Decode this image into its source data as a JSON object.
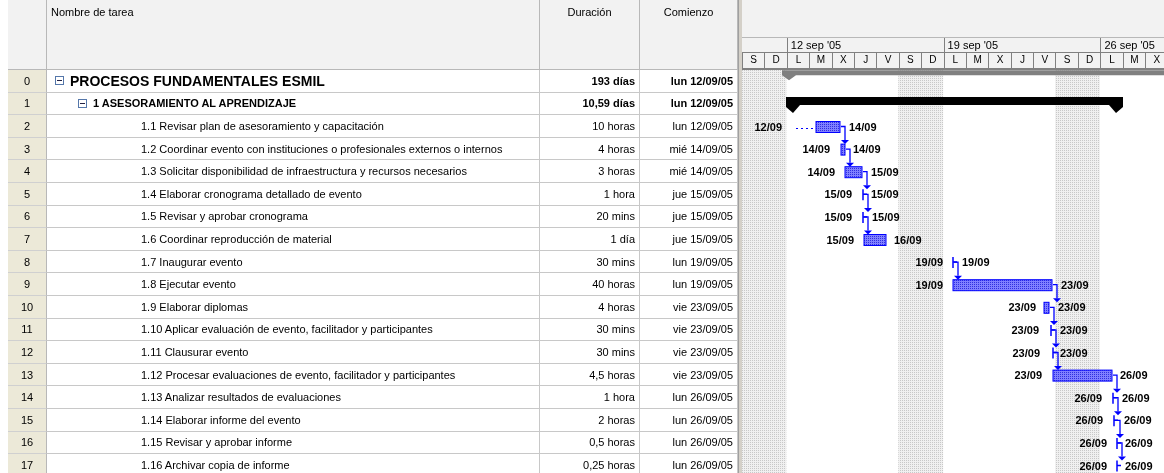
{
  "table": {
    "columns": [
      "Nombre de tarea",
      "Duración",
      "Comienzo"
    ]
  },
  "timescale": {
    "weeks": [
      "12 sep '05",
      "19 sep '05",
      "26 sep '05"
    ],
    "days": [
      "S",
      "D",
      "L",
      "M",
      "X",
      "J",
      "V",
      "S",
      "D",
      "L",
      "M",
      "X",
      "J",
      "V",
      "S",
      "D",
      "L",
      "M",
      "X"
    ]
  },
  "tasks": [
    {
      "id": "0",
      "name": "PROCESOS FUNDAMENTALES ESMIL",
      "duration": "193 días",
      "start": "lun 12/09/05",
      "kind": "project",
      "expanded": true,
      "children": [
        {
          "id": "1",
          "name": "1 ASESORAMIENTO AL APRENDIZAJE",
          "duration": "10,59 días",
          "start": "lun 12/09/05",
          "kind": "summary",
          "expanded": true,
          "children": [
            {
              "id": "2",
              "name": "1.1 Revisar plan de asesoramiento y capacitación",
              "duration": "10 horas",
              "start": "lun 12/09/05",
              "kind": "task",
              "bar_start": "12/09",
              "bar_end": "14/09"
            },
            {
              "id": "3",
              "name": "1.2 Coordinar evento con instituciones o profesionales externos o internos",
              "duration": "4 horas",
              "start": "mié 14/09/05",
              "kind": "task",
              "bar_start": "14/09",
              "bar_end": "14/09"
            },
            {
              "id": "4",
              "name": "1.3 Solicitar disponibilidad de infraestructura y recursos necesarios",
              "duration": "3 horas",
              "start": "mié 14/09/05",
              "kind": "task",
              "bar_start": "14/09",
              "bar_end": "15/09"
            },
            {
              "id": "5",
              "name": "1.4 Elaborar cronograma detallado de evento",
              "duration": "1 hora",
              "start": "jue 15/09/05",
              "kind": "task",
              "bar_start": "15/09",
              "bar_end": "15/09"
            },
            {
              "id": "6",
              "name": "1.5 Revisar y aprobar cronograma",
              "duration": "20 mins",
              "start": "jue 15/09/05",
              "kind": "task",
              "bar_start": "15/09",
              "bar_end": "15/09"
            },
            {
              "id": "7",
              "name": "1.6 Coordinar reproducción de material",
              "duration": "1 día",
              "start": "jue 15/09/05",
              "kind": "task",
              "bar_start": "15/09",
              "bar_end": "16/09"
            },
            {
              "id": "8",
              "name": "1.7 Inaugurar evento",
              "duration": "30 mins",
              "start": "lun 19/09/05",
              "kind": "task",
              "bar_start": "19/09",
              "bar_end": "19/09"
            },
            {
              "id": "9",
              "name": "1.8 Ejecutar evento",
              "duration": "40 horas",
              "start": "lun 19/09/05",
              "kind": "task",
              "bar_start": "19/09",
              "bar_end": "23/09"
            },
            {
              "id": "10",
              "name": "1.9 Elaborar diplomas",
              "duration": "4 horas",
              "start": "vie 23/09/05",
              "kind": "task",
              "bar_start": "23/09",
              "bar_end": "23/09"
            },
            {
              "id": "11",
              "name": "1.10 Aplicar evaluación de evento, facilitador y participantes",
              "duration": "30 mins",
              "start": "vie 23/09/05",
              "kind": "task",
              "bar_start": "23/09",
              "bar_end": "23/09"
            },
            {
              "id": "12",
              "name": "1.11 Clausurar evento",
              "duration": "30 mins",
              "start": "vie 23/09/05",
              "kind": "task",
              "bar_start": "23/09",
              "bar_end": "23/09"
            },
            {
              "id": "13",
              "name": "1.12 Procesar evaluaciones de evento, facilitador y participantes",
              "duration": "4,5 horas",
              "start": "vie 23/09/05",
              "kind": "task",
              "bar_start": "23/09",
              "bar_end": "26/09"
            },
            {
              "id": "14",
              "name": "1.13 Analizar resultados de evaluaciones",
              "duration": "1 hora",
              "start": "lun 26/09/05",
              "kind": "task",
              "bar_start": "26/09",
              "bar_end": "26/09"
            },
            {
              "id": "15",
              "name": "1.14 Elaborar informe del evento",
              "duration": "2 horas",
              "start": "lun 26/09/05",
              "kind": "task",
              "bar_start": "26/09",
              "bar_end": "26/09"
            },
            {
              "id": "16",
              "name": "1.15 Revisar y aprobar informe",
              "duration": "0,5 horas",
              "start": "lun 26/09/05",
              "kind": "task",
              "bar_start": "26/09",
              "bar_end": "26/09"
            },
            {
              "id": "17",
              "name": "1.16 Archivar copia de informe",
              "duration": "0,25 horas",
              "start": "lun 26/09/05",
              "kind": "task",
              "bar_start": "26/09",
              "bar_end": "26/09"
            }
          ]
        }
      ]
    }
  ]
}
